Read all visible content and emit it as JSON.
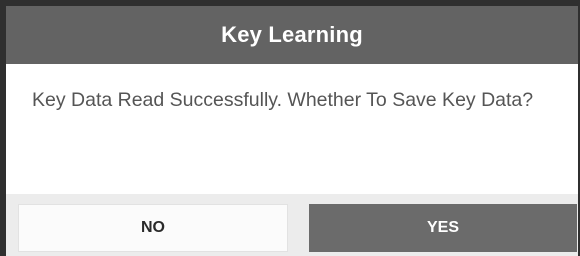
{
  "dialog": {
    "title": "Key Learning",
    "message": "Key Data Read Successfully. Whether To Save Key Data?",
    "buttons": {
      "no_label": "NO",
      "yes_label": "YES"
    }
  },
  "colors": {
    "title_bar": "#636363",
    "yes_button": "#6b6b6b",
    "no_button": "#fbfbfb"
  }
}
